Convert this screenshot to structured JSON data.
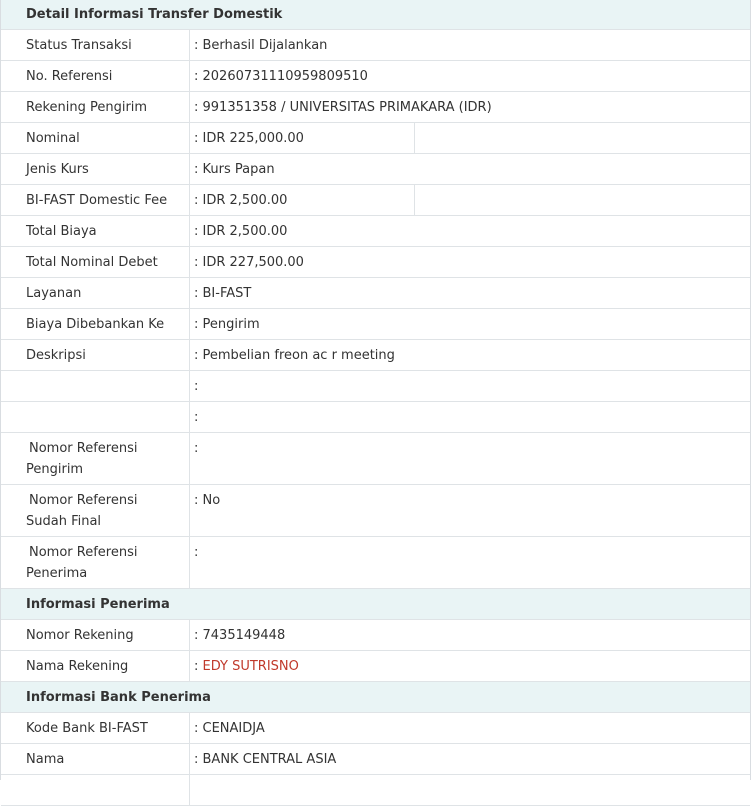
{
  "section_transfer": "Detail Informasi Transfer Domestik",
  "transfer_rows": [
    {
      "label": "Status Transaksi",
      "value": ": Berhasil Dijalankan"
    },
    {
      "label": "No. Referensi",
      "value": ": 20260731110959809510"
    },
    {
      "label": "Rekening Pengirim",
      "value": ": 991351358 / UNIVERSITAS PRIMAKARA (IDR)"
    },
    {
      "label": "Nominal",
      "value": ": IDR  225,000.00"
    },
    {
      "label": "Jenis Kurs",
      "value": ": Kurs Papan"
    },
    {
      "label": "BI-FAST Domestic Fee",
      "value": ": IDR 2,500.00"
    },
    {
      "label": "Total Biaya",
      "value": ": IDR  2,500.00"
    },
    {
      "label": "Total Nominal Debet",
      "value": ": IDR  227,500.00"
    },
    {
      "label": "Layanan",
      "value": ": BI-FAST"
    },
    {
      "label": "Biaya Dibebankan Ke",
      "value": ": Pengirim"
    },
    {
      "label": "Deskripsi",
      "value": ": Pembelian freon ac r meeting"
    },
    {
      "label": "",
      "value": ":"
    },
    {
      "label": "",
      "value": ":"
    }
  ],
  "reference_rows": [
    {
      "label_line1": "Nomor Referensi",
      "label_line2": "Pengirim",
      "value": ":"
    },
    {
      "label_line1": "Nomor Referensi",
      "label_line2": "Sudah Final",
      "value": ": No"
    },
    {
      "label_line1": "Nomor Referensi",
      "label_line2": "Penerima",
      "value": ":"
    }
  ],
  "section_recipient": "Informasi Penerima",
  "recipient_rows": [
    {
      "label": "Nomor Rekening",
      "value": ": 7435149448"
    },
    {
      "label": "Nama Rekening",
      "value_prefix": ": ",
      "value": "EDY SUTRISNO"
    }
  ],
  "section_bank": "Informasi Bank Penerima",
  "bank_rows": [
    {
      "label": "Kode Bank BI-FAST",
      "value": ": CENAIDJA"
    },
    {
      "label": "Nama",
      "value": ": BANK CENTRAL ASIA"
    }
  ],
  "colors": {
    "section_bg": "#e9f4f5",
    "highlight_red": "#c0392b",
    "border": "#dfe3e6"
  }
}
